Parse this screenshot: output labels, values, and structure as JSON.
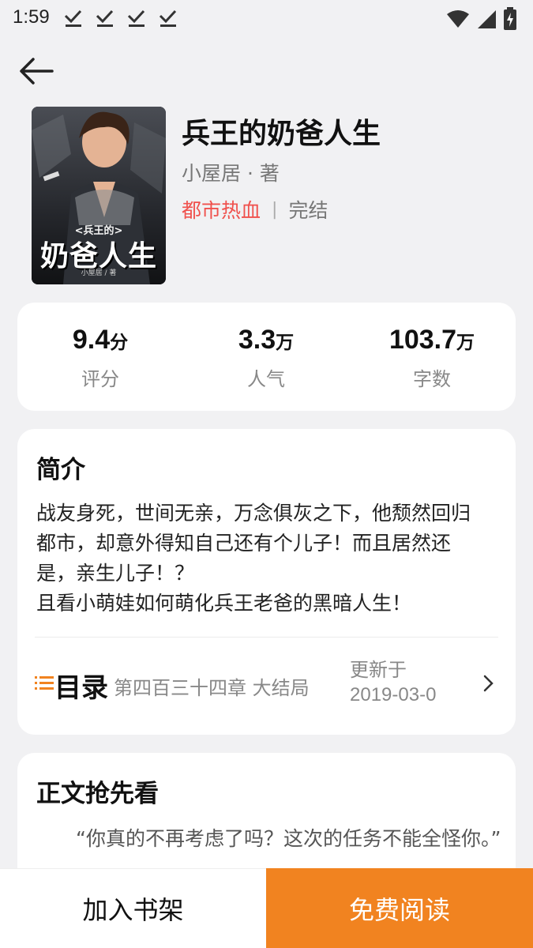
{
  "status_bar": {
    "time": "1:59",
    "icons": [
      "download-done-icon",
      "download-done-icon",
      "download-done-icon",
      "download-done-icon",
      "wifi-icon",
      "signal-icon",
      "battery-charging-icon"
    ]
  },
  "header": {
    "back_icon": "arrow-left-icon"
  },
  "book": {
    "cover_text": {
      "small": "<兵王的>",
      "big": "奶爸人生",
      "author": "小屋居 / 著"
    },
    "title": "兵王的奶爸人生",
    "author": "小屋居 · 著",
    "genre": "都市热血",
    "separator": "|",
    "status": "完结"
  },
  "stats": [
    {
      "value": "9.4",
      "unit": "分",
      "label": "评分"
    },
    {
      "value": "3.3",
      "unit": "万",
      "label": "人气"
    },
    {
      "value": "103.7",
      "unit": "万",
      "label": "字数"
    }
  ],
  "intro": {
    "title": "简介",
    "lines": [
      "战友身死，世间无亲，万念俱灰之下，他颓然回归",
      "都市，却意外得知自己还有个儿子！而且居然还",
      "是，亲生儿子！？",
      "且看小萌娃如何萌化兵王老爸的黑暗人生！"
    ]
  },
  "toc": {
    "icon": "list-icon",
    "label": "目录",
    "latest_chapter": "第四百三十四章 大结局",
    "update_prefix": "更新于",
    "update_date": "2019-03-0",
    "chevron": "chevron-right-icon"
  },
  "preview": {
    "title": "正文抢先看",
    "text": "“你真的不再考虑了吗？这次的任务不能全怪你。”"
  },
  "actions": {
    "add_to_shelf": "加入书架",
    "read_free": "免费阅读"
  },
  "colors": {
    "accent_orange": "#f18320",
    "genre_red": "#f0514d",
    "background": "#f1f1f3",
    "card": "#ffffff"
  }
}
